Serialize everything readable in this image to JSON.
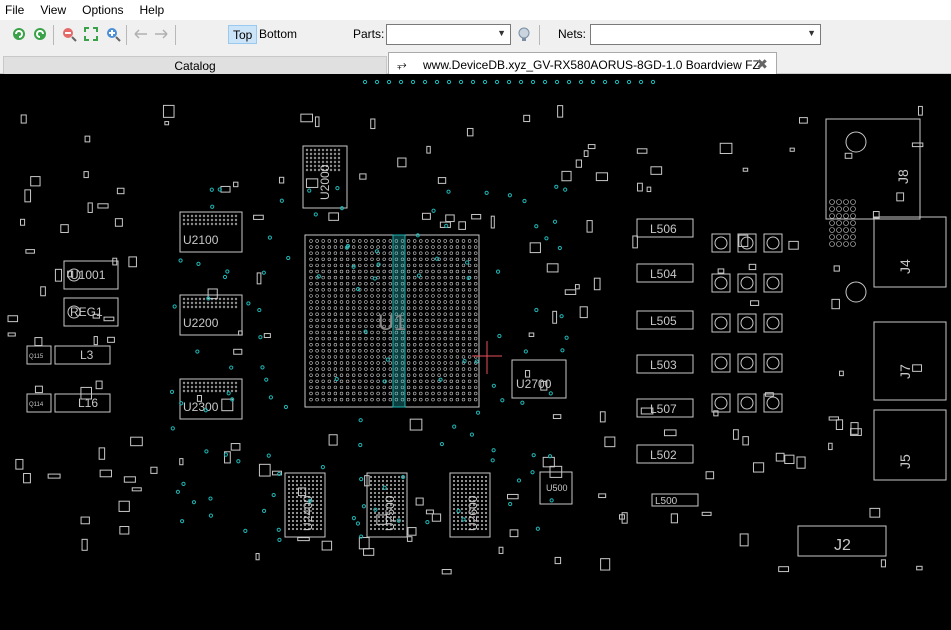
{
  "menu": [
    "File",
    "View",
    "Options",
    "Help"
  ],
  "toolbar": {
    "top_label": "Top",
    "bottom_label": "Bottom",
    "parts_label": "Parts:",
    "parts_value": "",
    "nets_label": "Nets:",
    "nets_value": ""
  },
  "tabs": {
    "catalog": "Catalog",
    "board": "www.DeviceDB.xyz_GV-RX580AORUS-8GD-1.0 Boardview FZ"
  },
  "board": {
    "gpu": "U1",
    "memory_chips": [
      "U2100",
      "U2200",
      "U2300",
      "U2000",
      "U2400",
      "U2500",
      "U2600"
    ],
    "regulator": "U2700",
    "connectors": [
      "J8",
      "J4",
      "J7",
      "J5",
      "J2"
    ],
    "left_parts": [
      "U1001",
      "REG1",
      "L3",
      "L16",
      "Q115",
      "Q114"
    ],
    "inductors": [
      "L506",
      "L504",
      "L505",
      "L503",
      "L507",
      "L502",
      "L500"
    ],
    "misc": [
      "U500"
    ],
    "colors": {
      "trace": "#c8c8c8",
      "via": "#1fb5b5",
      "background": "#000000",
      "cursor": "#e8505a"
    }
  }
}
